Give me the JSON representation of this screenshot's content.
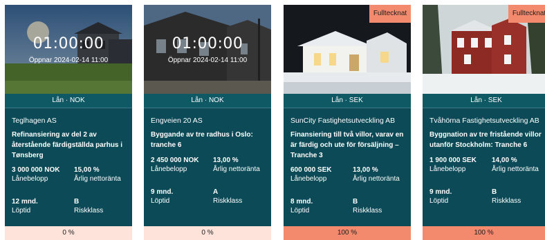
{
  "cards": [
    {
      "timer": "01:00:00",
      "opens": "Öppnar 2024-02-14 11:00",
      "loan_type": "Lån · NOK",
      "issuer": "Teglhagen AS",
      "description": "Refinansiering av del 2 av återstående färdigställda parhus i Tønsberg",
      "amount": "3 000 000 NOK",
      "amount_label": "Lånebelopp",
      "rate": "15,00 %",
      "rate_label": "Årlig nettoränta",
      "term": "12 mnd.",
      "term_label": "Löptid",
      "risk": "B",
      "risk_label": "Riskklass",
      "progress_text": "0 %",
      "progress": 0
    },
    {
      "timer": "01:00:00",
      "opens": "Öppnar 2024-02-14 11:00",
      "loan_type": "Lån · NOK",
      "issuer": "Engveien 20 AS",
      "description": "Byggande av tre radhus i Oslo: tranche 6",
      "amount": "2 450 000 NOK",
      "amount_label": "Lånebelopp",
      "rate": "13,00 %",
      "rate_label": "Årlig nettoränta",
      "term": "9 mnd.",
      "term_label": "Löptid",
      "risk": "A",
      "risk_label": "Riskklass",
      "progress_text": "0 %",
      "progress": 0
    },
    {
      "badge": "Fulltecknat",
      "loan_type": "Lån · SEK",
      "issuer": "SunCity Fastighetsutveckling AB",
      "description": "Finansiering till två villor, varav en är färdig och ute för försäljning – Tranche 3",
      "amount": "600 000 SEK",
      "amount_label": "Lånebelopp",
      "rate": "13,00 %",
      "rate_label": "Årlig nettoränta",
      "term": "8 mnd.",
      "term_label": "Löptid",
      "risk": "B",
      "risk_label": "Riskklass",
      "progress_text": "100 %",
      "progress": 100
    },
    {
      "badge": "Fulltecknat",
      "loan_type": "Lån · SEK",
      "issuer": "Tvåhörna Fastighetsutveckling AB",
      "description": "Byggnation av tre fristående villor utanför Stockholm: Tranche 6",
      "amount": "1 900 000 SEK",
      "amount_label": "Lånebelopp",
      "rate": "14,00 %",
      "rate_label": "Årlig nettoränta",
      "term": "9 mnd.",
      "term_label": "Löptid",
      "risk": "B",
      "risk_label": "Riskklass",
      "progress_text": "100 %",
      "progress": 100
    }
  ]
}
